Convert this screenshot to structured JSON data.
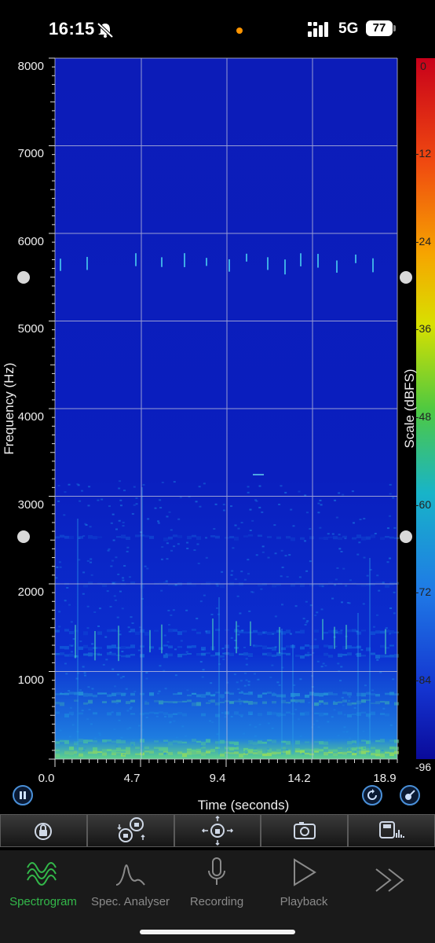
{
  "status": {
    "time": "16:15",
    "network": "5G",
    "battery": "77"
  },
  "spectrogram": {
    "y_axis": {
      "title": "Frequency (Hz)",
      "ticks": [
        "8000",
        "7000",
        "6000",
        "5000",
        "4000",
        "3000",
        "2000",
        "1000"
      ]
    },
    "x_axis": {
      "title": "Time (seconds)",
      "ticks": [
        "0.0",
        "4.7",
        "9.4",
        "14.2",
        "18.9"
      ]
    },
    "scale": {
      "title": "Scale (dBFS)",
      "ticks": [
        "0",
        "-12",
        "-24",
        "-36",
        "-48",
        "-60",
        "-72",
        "-84",
        "-96"
      ]
    },
    "colors": {
      "background": "#0a1ab0",
      "grid": "#c8c8dc"
    }
  },
  "toolbar": {
    "items": [
      "lock-icon",
      "move-zoom-icon",
      "pan-icon",
      "snapshot-icon",
      "save-icon"
    ]
  },
  "tabs": [
    {
      "label": "Spectrogram",
      "icon": "waveform-icon",
      "active": true
    },
    {
      "label": "Spec. Analyser",
      "icon": "peak-icon",
      "active": false
    },
    {
      "label": "Recording",
      "icon": "microphone-icon",
      "active": false
    },
    {
      "label": "Playback",
      "icon": "play-icon",
      "active": false
    },
    {
      "label": "",
      "icon": "more-icon",
      "active": false
    }
  ]
}
